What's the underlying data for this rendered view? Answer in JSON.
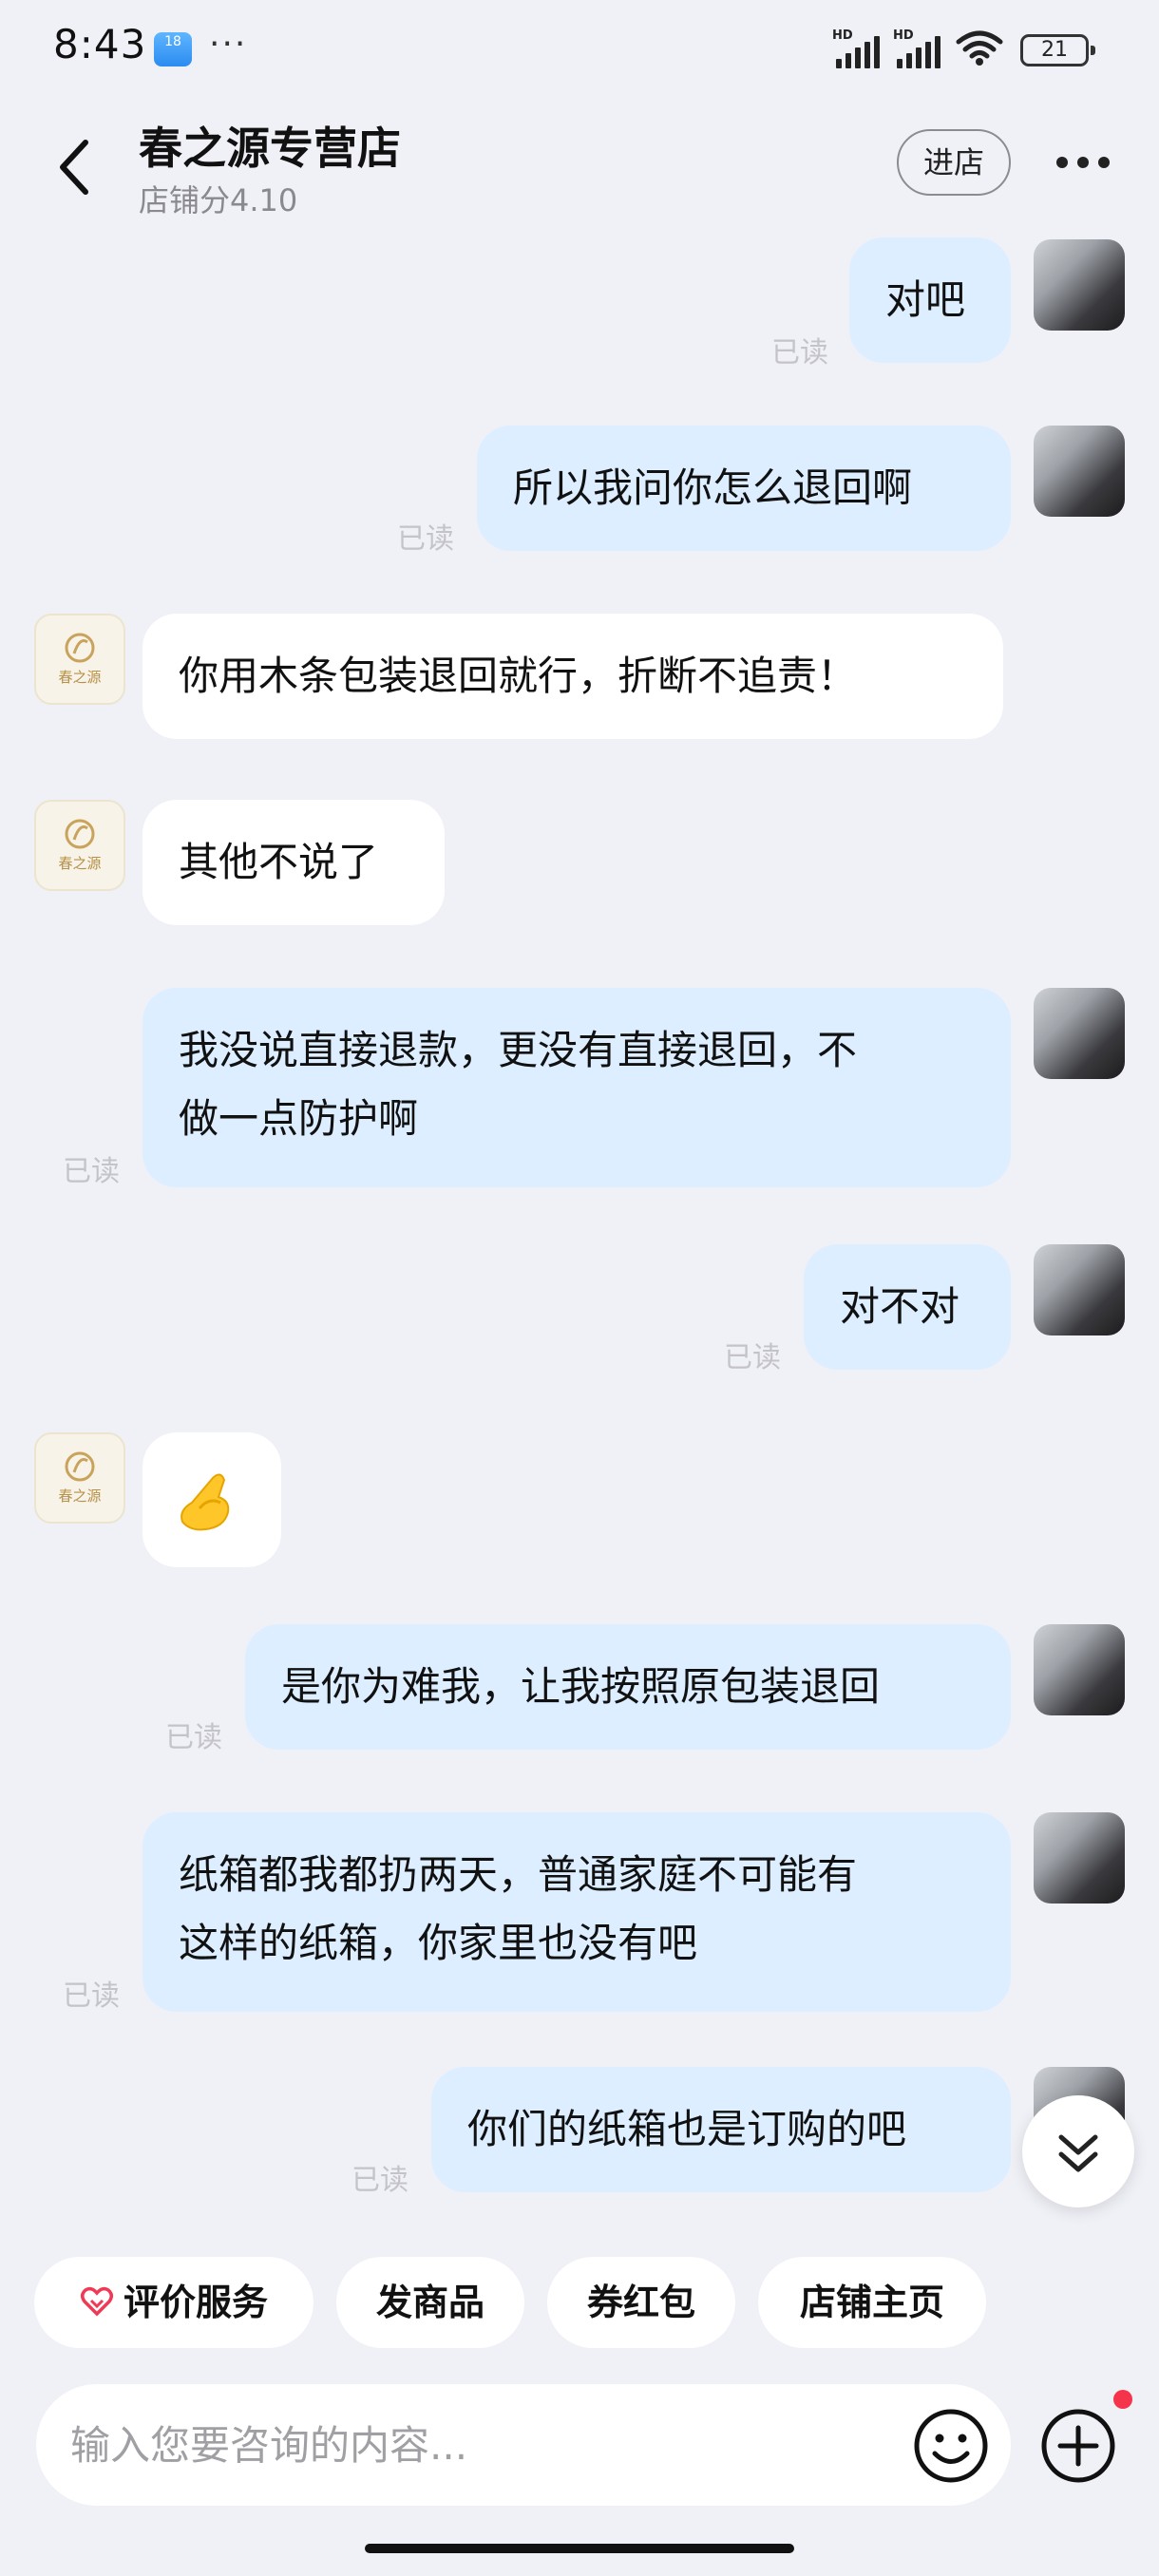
{
  "status_bar": {
    "time": "8:43",
    "weather_badge": "18",
    "dots": "···",
    "signal_1_label": "HD",
    "signal_2_label": "HD",
    "battery": "21"
  },
  "header": {
    "shop_name": "春之源专营店",
    "shop_score": "店铺分4.10",
    "enter_store": "进店"
  },
  "messages": [
    {
      "side": "right",
      "text": "对吧",
      "read": "已读"
    },
    {
      "side": "right",
      "text": "所以我问你怎么退回啊",
      "read": "已读"
    },
    {
      "side": "left",
      "text": "你用木条包装退回就行，折断不追责！"
    },
    {
      "side": "left",
      "text": "其他不说了"
    },
    {
      "side": "right",
      "text_lines": [
        "我没说直接退款，更没有直接退回，不",
        "做一点防护啊"
      ],
      "read": "已读"
    },
    {
      "side": "right",
      "text": "对不对",
      "read": "已读"
    },
    {
      "side": "left",
      "text": "🙏"
    },
    {
      "side": "right",
      "text": "是你为难我，让我按照原包装退回",
      "read": "已读"
    },
    {
      "side": "right",
      "text_lines": [
        "纸箱都我都扔两天，普通家庭不可能有",
        "这样的纸箱，你家里也没有吧"
      ],
      "read": "已读"
    },
    {
      "side": "right",
      "text": "你们的纸箱也是订购的吧",
      "read": "已读"
    }
  ],
  "shop_avatar_text": "春之源",
  "quick_actions": [
    "评价服务",
    "发商品",
    "券红包",
    "店铺主页"
  ],
  "input": {
    "placeholder": "输入您要咨询的内容..."
  },
  "colors": {
    "background": "#f0f0f7",
    "my_bubble": "#dceeff",
    "their_bubble": "#ffffff",
    "read_label": "#c4c4c8",
    "heart_accent": "#f03a55",
    "notify_dot": "#f5334a"
  },
  "icons": [
    "back-icon",
    "more-icon",
    "heart-icon",
    "emoji-icon",
    "plus-icon",
    "chevron-down-icon",
    "wifi-icon",
    "weather-icon"
  ]
}
